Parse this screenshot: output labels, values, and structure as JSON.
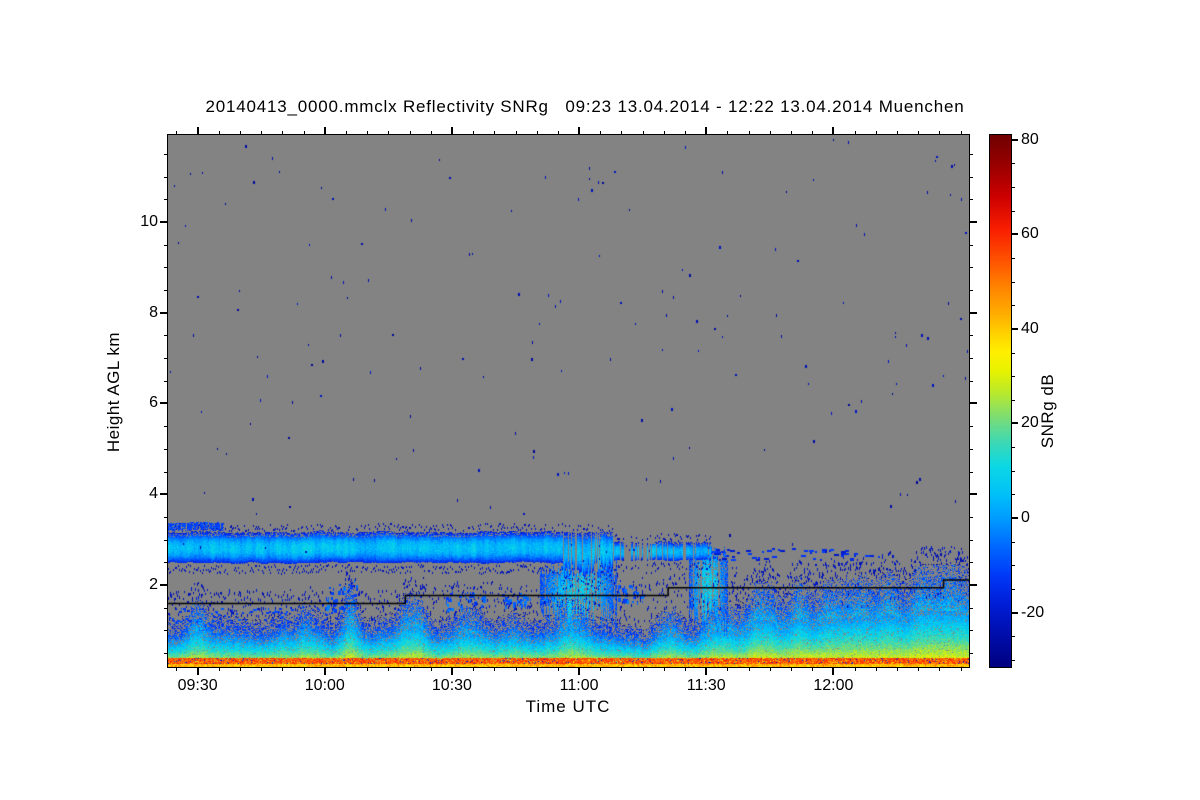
{
  "chart_data": {
    "type": "heatmap",
    "title": "20140413_0000.mmclx Reflectivity SNRg   09:23 13.04.2014 - 12:22 13.04.2014 Muenchen",
    "file": "20140413_0000.mmclx",
    "quantity": "Reflectivity SNRg",
    "station": "Muenchen",
    "time_window": [
      "09:23 13.04.2014",
      "12:22 13.04.2014"
    ],
    "xlabel": "Time UTC",
    "ylabel": "Height AGL km",
    "x_axis": {
      "ticks": [
        {
          "label": "09:30",
          "min": 570
        },
        {
          "label": "10:00",
          "min": 600
        },
        {
          "label": "10:30",
          "min": 630
        },
        {
          "label": "11:00",
          "min": 660
        },
        {
          "label": "11:30",
          "min": 690
        },
        {
          "label": "12:00",
          "min": 720
        }
      ],
      "minor_step_min": 5,
      "range_min": [
        563,
        752
      ]
    },
    "y_axis": {
      "ticks": [
        2,
        4,
        6,
        8,
        10
      ],
      "minor_step_km": 0.5,
      "range_km": [
        0.19,
        11.92
      ]
    },
    "colorbar": {
      "label": "SNRg dB",
      "tick_values": [
        80,
        60,
        40,
        20,
        0,
        -20
      ],
      "minor_step_db": 5,
      "range_db": [
        -31.5,
        81
      ],
      "stops": [
        [
          81,
          "#700000"
        ],
        [
          75,
          "#960000"
        ],
        [
          68,
          "#cc0000"
        ],
        [
          61,
          "#f81e00"
        ],
        [
          54,
          "#ff5600"
        ],
        [
          48,
          "#ff8a00"
        ],
        [
          43,
          "#ffae00"
        ],
        [
          39,
          "#ffd200"
        ],
        [
          35,
          "#fff000"
        ],
        [
          31,
          "#e6f200"
        ],
        [
          26,
          "#b4e832"
        ],
        [
          21,
          "#78dc78"
        ],
        [
          16,
          "#3cd8b4"
        ],
        [
          11,
          "#0cd8e4"
        ],
        [
          5,
          "#00c0f8"
        ],
        [
          0,
          "#009cff"
        ],
        [
          -6,
          "#0068ff"
        ],
        [
          -12,
          "#003af8"
        ],
        [
          -18,
          "#001ed8"
        ],
        [
          -24,
          "#000fb0"
        ],
        [
          -31.5,
          "#000080"
        ]
      ]
    },
    "palette": {
      "no_signal_gray": "#838383",
      "frame": "#000000",
      "page_bg": "#ffffff",
      "range_line": "#000000"
    },
    "features": [
      {
        "name": "cloud-layer",
        "h_top_km": 3.15,
        "h_bot_km": 2.5,
        "presence": [
          [
            563,
            656,
            1.0
          ],
          [
            656,
            668,
            0.8
          ],
          [
            668,
            677,
            0.35
          ],
          [
            677,
            691,
            0.85
          ]
        ],
        "snr_core_db": 8,
        "snr_edge_db": -17
      },
      {
        "name": "cloud-top-strip",
        "t_min": [
          563,
          576
        ],
        "h_km": [
          3.2,
          3.36
        ],
        "snr_db": -12
      },
      {
        "name": "cloud-remnant-dashes",
        "t_min": [
          691,
          731
        ],
        "h_km": [
          2.55,
          2.8
        ],
        "count": 60,
        "snr_db": -16
      },
      {
        "name": "virga-events",
        "snr_db": 10,
        "events": [
          {
            "t_min": [
              651,
              669
            ],
            "h_km": [
              0.95,
              2.55
            ]
          },
          {
            "t_min": [
              686,
              695
            ],
            "h_km": [
              0.85,
              2.85
            ]
          }
        ]
      },
      {
        "name": "midlevel-patches",
        "snr_db": -8,
        "blobs": [
          [
            604,
            8,
            1.45,
            2.1
          ],
          [
            633,
            9,
            1.45,
            1.85
          ],
          [
            645,
            7,
            1.5,
            1.8
          ],
          [
            655,
            8,
            1.6,
            2.3
          ],
          [
            672,
            6,
            1.6,
            2.0
          ]
        ]
      },
      {
        "name": "boundary-layer",
        "h_top_base_km": 1.2,
        "h_top_right_km": 1.75,
        "snr_top_db": -16,
        "snr_bot_db": 36,
        "stripe_snr_db": 52,
        "plume_t_min": [
          606,
          693,
          702,
          712,
          719,
          726,
          733,
          741,
          747
        ],
        "plume_amp_km": [
          0.85,
          0.55,
          0.6,
          0.75,
          0.6,
          0.7,
          0.65,
          0.8,
          0.9
        ],
        "low_layer_left": {
          "t_max_min": 602,
          "h_km": [
            1.0,
            1.5
          ]
        }
      },
      {
        "name": "extra-specks-midlevel",
        "t_min": [
          656,
          752
        ],
        "h_km": [
          1.5,
          2.6
        ],
        "count": 170
      },
      {
        "name": "noise-specks",
        "h_km": [
          1.9,
          11.9
        ],
        "count": 175
      },
      {
        "name": "range-line",
        "color": "#000000",
        "segments": [
          [
            563,
            619,
            1.6
          ],
          [
            619,
            681,
            1.78
          ],
          [
            681,
            746,
            1.95
          ],
          [
            746,
            752,
            2.12
          ]
        ]
      }
    ]
  }
}
